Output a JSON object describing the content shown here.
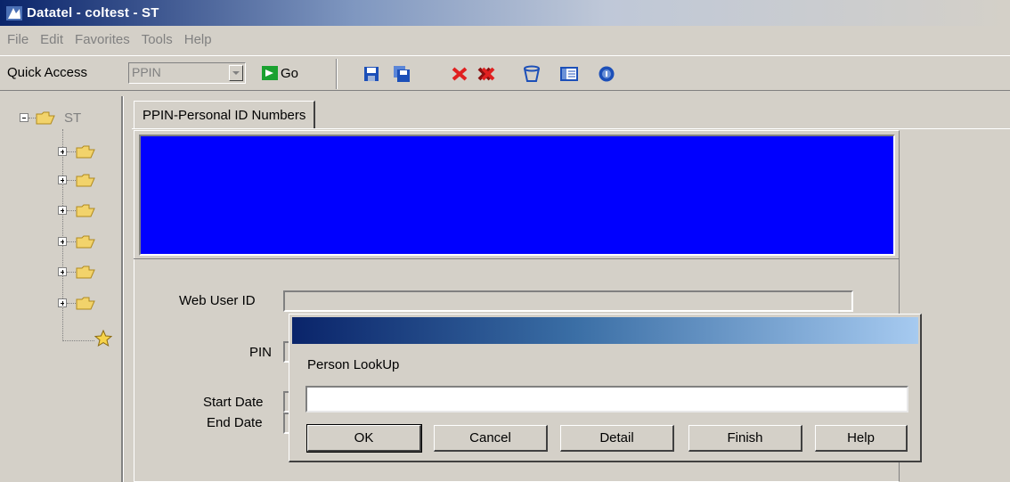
{
  "window": {
    "title": "Datatel - coltest - ST"
  },
  "menu": [
    "File",
    "Edit",
    "Favorites",
    "Tools",
    "Help"
  ],
  "toolbar": {
    "quick_access_label": "Quick Access",
    "quick_access_value": "PPIN",
    "go_label": "Go",
    "icons": [
      "save-icon",
      "save-all-icon",
      "cancel-icon",
      "cancel-all-icon",
      "delete-icon",
      "details-icon",
      "help-icon"
    ]
  },
  "tree": {
    "root_label": "ST",
    "child_count": 6
  },
  "tab": {
    "label": "PPIN-Personal ID Numbers"
  },
  "colors": {
    "banner": "#0000ff",
    "dialog_title_start": "#0a246a",
    "dialog_title_end": "#a6caf0"
  },
  "form": {
    "web_user_id_label": "Web User ID",
    "pin_label": "PIN",
    "start_date_label": "Start Date",
    "end_date_label": "End Date"
  },
  "dialog": {
    "label": "Person LookUp",
    "input_value": "",
    "buttons": {
      "ok": "OK",
      "cancel": "Cancel",
      "detail": "Detail",
      "finish": "Finish",
      "help": "Help"
    }
  }
}
